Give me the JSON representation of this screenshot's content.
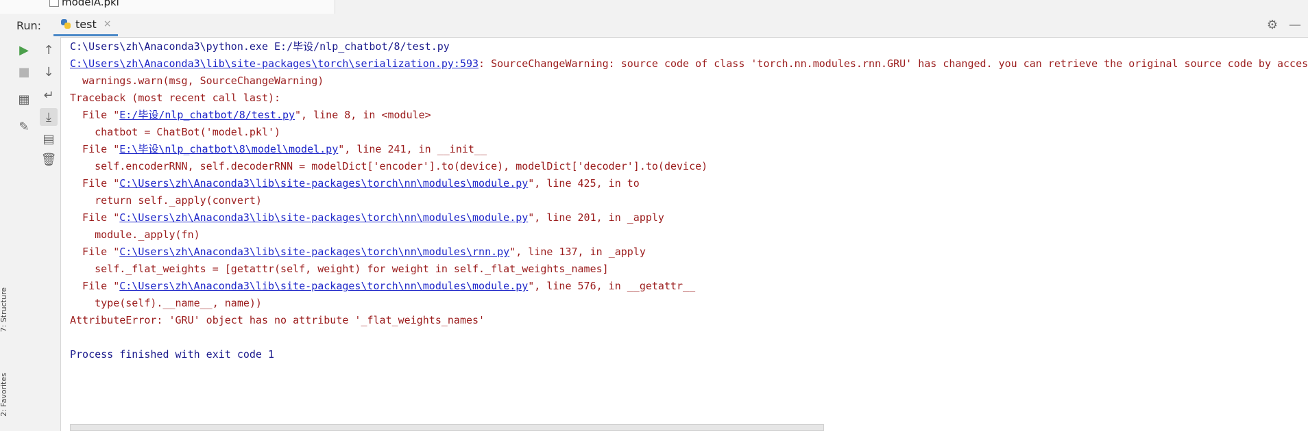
{
  "top_file": {
    "name": "modelA.pkl"
  },
  "run_header": {
    "label": "Run:",
    "tab_title": "test",
    "tab_close": "×",
    "settings_icon": "⚙",
    "minimize_icon": "—"
  },
  "sidebar": {
    "structure_label": "7: Structure",
    "favorites_label": "2: Favorites"
  },
  "toolbar": {
    "icons": [
      "play-icon",
      "stop-icon",
      "layout-icon",
      "pin-icon",
      "up-arrow-icon",
      "down-arrow-icon",
      "soft-wrap-icon",
      "scroll-to-end-icon",
      "print-icon",
      "trash-icon"
    ]
  },
  "console": {
    "l1": "C:\\Users\\zh\\Anaconda3\\python.exe E:/毕设/nlp_chatbot/8/test.py",
    "l2_link": "C:\\Users\\zh\\Anaconda3\\lib\\site-packages\\torch\\serialization.py:593",
    "l2_text": ": SourceChangeWarning: source code of class 'torch.nn.modules.rnn.GRU' has changed. you can retrieve the original source code by accessing",
    "l3": "  warnings.warn(msg, SourceChangeWarning)",
    "l4": "Traceback (most recent call last):",
    "l5_pre": "  File \"",
    "l5_link": "E:/毕设/nlp_chatbot/8/test.py",
    "l5_post": "\", line 8, in <module>",
    "l6": "    chatbot = ChatBot('model.pkl')",
    "l7_pre": "  File \"",
    "l7_link": "E:\\毕设\\nlp_chatbot\\8\\model\\model.py",
    "l7_post": "\", line 241, in __init__",
    "l8": "    self.encoderRNN, self.decoderRNN = modelDict['encoder'].to(device), modelDict['decoder'].to(device)",
    "l9_pre": "  File \"",
    "l9_link": "C:\\Users\\zh\\Anaconda3\\lib\\site-packages\\torch\\nn\\modules\\module.py",
    "l9_post": "\", line 425, in to",
    "l10": "    return self._apply(convert)",
    "l11_pre": "  File \"",
    "l11_link": "C:\\Users\\zh\\Anaconda3\\lib\\site-packages\\torch\\nn\\modules\\module.py",
    "l11_post": "\", line 201, in _apply",
    "l12": "    module._apply(fn)",
    "l13_pre": "  File \"",
    "l13_link": "C:\\Users\\zh\\Anaconda3\\lib\\site-packages\\torch\\nn\\modules\\rnn.py",
    "l13_post": "\", line 137, in _apply",
    "l14": "    self._flat_weights = [getattr(self, weight) for weight in self._flat_weights_names]",
    "l15_pre": "  File \"",
    "l15_link": "C:\\Users\\zh\\Anaconda3\\lib\\site-packages\\torch\\nn\\modules\\module.py",
    "l15_post": "\", line 576, in __getattr__",
    "l16": "    type(self).__name__, name))",
    "l17": "AttributeError: 'GRU' object has no attribute '_flat_weights_names'",
    "l19": "Process finished with exit code 1"
  }
}
